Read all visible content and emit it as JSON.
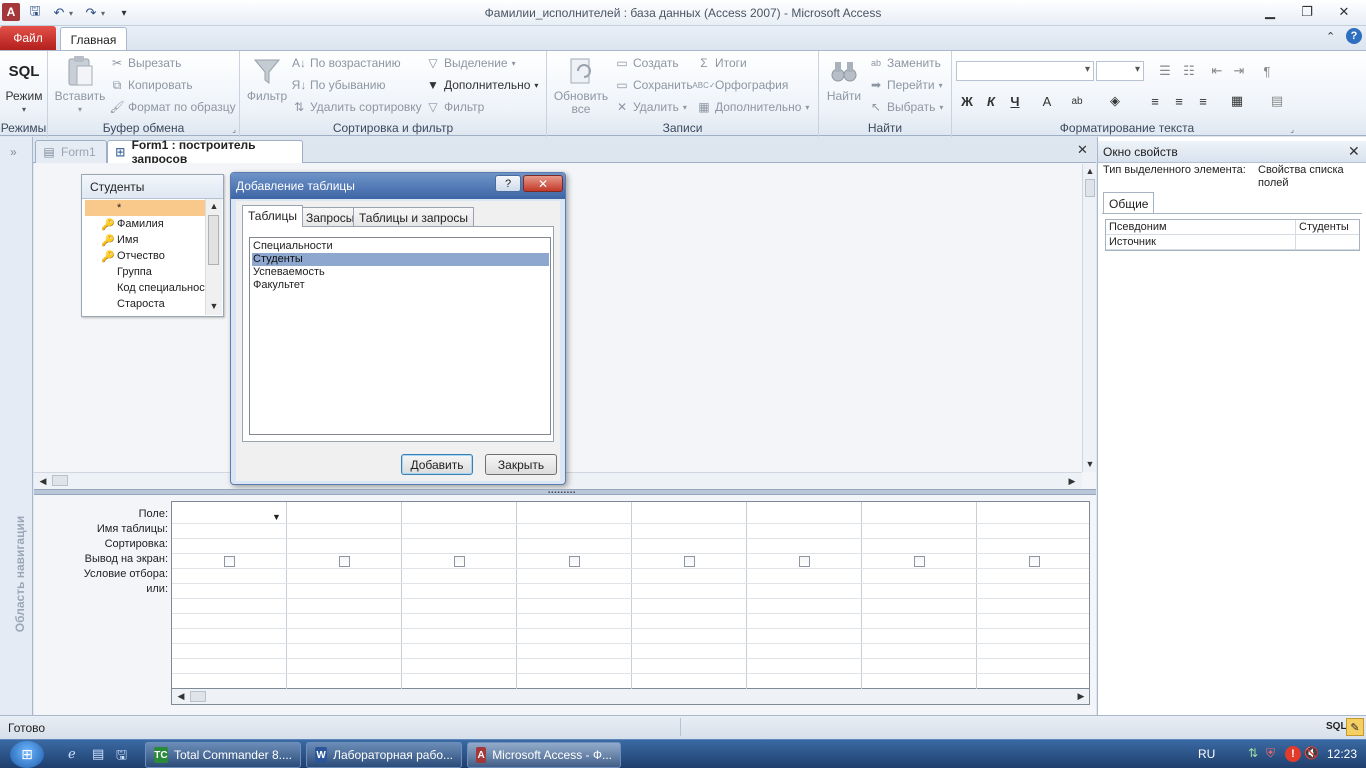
{
  "window": {
    "title": "Фамилии_исполнителей : база данных (Access 2007)  -  Microsoft Access"
  },
  "ribbon_tabs": {
    "file": "Файл",
    "home": "Главная"
  },
  "ribbon": {
    "views": {
      "sql": "SQL",
      "mode": "Режим",
      "group": "Режимы"
    },
    "clipboard": {
      "paste": "Вставить",
      "cut": "Вырезать",
      "copy": "Копировать",
      "format_painter": "Формат по образцу",
      "group": "Буфер обмена"
    },
    "sort_filter": {
      "filter": "Фильтр",
      "ascending": "По возрастанию",
      "descending": "По убыванию",
      "remove_sort": "Удалить сортировку",
      "selection": "Выделение",
      "advanced": "Дополнительно",
      "toggle_filter": "Фильтр",
      "group": "Сортировка и фильтр"
    },
    "records": {
      "refresh_1": "Обновить",
      "refresh_2": "все",
      "new": "Создать",
      "save": "Сохранить",
      "delete": "Удалить",
      "totals": "Итоги",
      "spelling": "Орфография",
      "more": "Дополнительно",
      "group": "Записи"
    },
    "find": {
      "find": "Найти",
      "replace": "Заменить",
      "goto": "Перейти",
      "select": "Выбрать",
      "group": "Найти"
    },
    "text_format": {
      "group": "Форматирование текста",
      "bold": "Ж",
      "italic": "К",
      "underline": "Ч"
    }
  },
  "nav_pane": {
    "label": "Область навигации"
  },
  "doc_tabs": {
    "tab1": "Form1",
    "tab2": "Form1 : построитель запросов"
  },
  "table_box": {
    "title": "Студенты",
    "fields": [
      {
        "name": "*",
        "key": false
      },
      {
        "name": "Фамилия",
        "key": true
      },
      {
        "name": "Имя",
        "key": true
      },
      {
        "name": "Отчество",
        "key": true
      },
      {
        "name": "Группа",
        "key": false
      },
      {
        "name": "Код специальности",
        "key": false
      },
      {
        "name": "Староста",
        "key": false
      }
    ]
  },
  "dialog": {
    "title": "Добавление таблицы",
    "help": "?",
    "tabs": [
      "Таблицы",
      "Запросы",
      "Таблицы и запросы"
    ],
    "items": [
      "Специальности",
      "Студенты",
      "Успеваемость",
      "Факультет"
    ],
    "selected_item": "Студенты",
    "add_button": "Добавить",
    "close_button": "Закрыть"
  },
  "query_grid": {
    "row_labels": [
      "Поле:",
      "Имя таблицы:",
      "Сортировка:",
      "Вывод на экран:",
      "Условие отбора:",
      "или:"
    ]
  },
  "property_sheet": {
    "title": "Окно свойств",
    "selection_label": "Тип выделенного элемента:",
    "selection_value": "Свойства списка полей",
    "tab": "Общие",
    "rows": [
      {
        "name": "Псевдоним",
        "value": "Студенты"
      },
      {
        "name": "Источник",
        "value": ""
      }
    ]
  },
  "status_bar": {
    "text": "Готово",
    "sql_badge": "SQL"
  },
  "taskbar": {
    "items": [
      "Total Commander 8....",
      "Лабораторная рабо...",
      "Microsoft Access - Ф..."
    ],
    "lang": "RU",
    "time": "12:23"
  },
  "colors": {
    "access_red": "#a4373a",
    "selection": "#8ea7cf",
    "taskbar": "#24477a"
  }
}
